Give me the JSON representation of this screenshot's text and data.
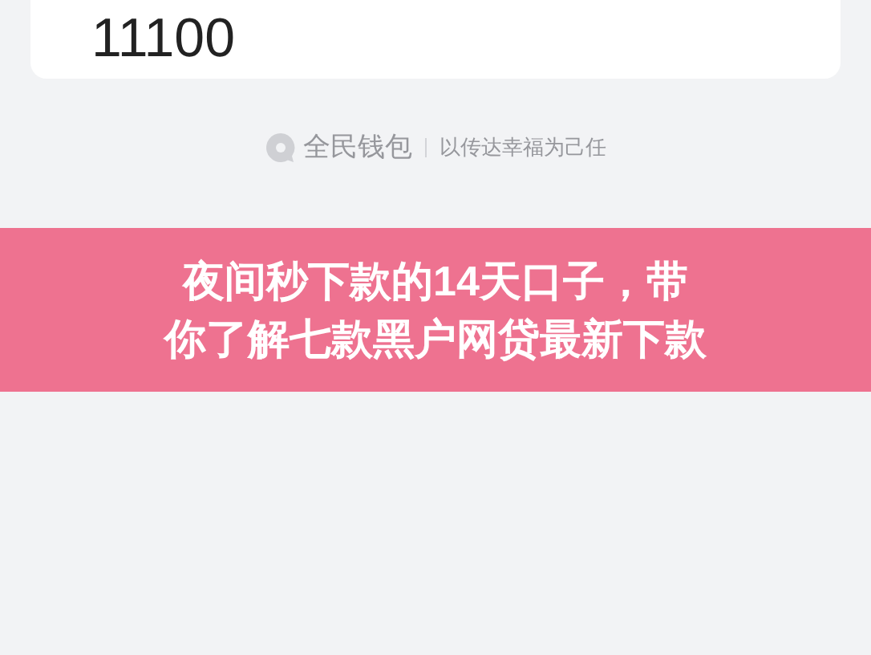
{
  "amount_card": {
    "amount": "11100"
  },
  "footer": {
    "brand": "全民钱包",
    "slogan": "以传达幸福为己任"
  },
  "banner": {
    "title_lines": [
      "夜间秒下款的14天口子，带",
      "你了解七款黑户网贷最新下款"
    ]
  }
}
